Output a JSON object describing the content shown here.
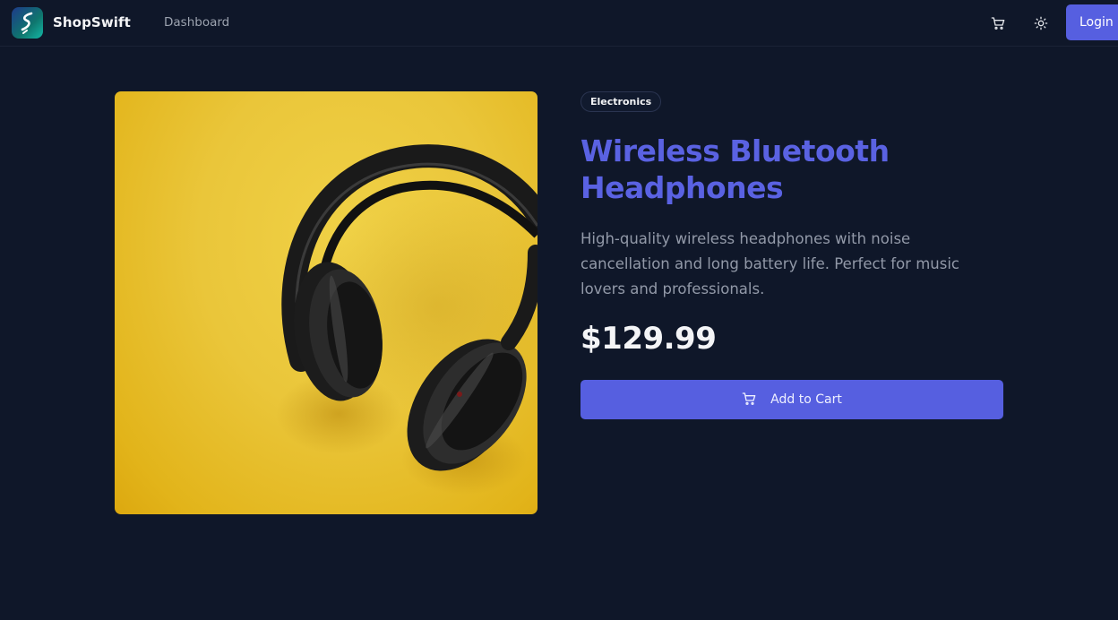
{
  "navbar": {
    "brand": "ShopSwift",
    "links": [
      {
        "label": "Dashboard"
      }
    ],
    "cart_icon": "cart-icon",
    "theme_icon": "sun-icon",
    "login_label": "Login"
  },
  "product": {
    "category": "Electronics",
    "title": "Wireless Bluetooth Headphones",
    "description": "High-quality wireless headphones with noise cancellation and long battery life. Perfect for music lovers and professionals.",
    "price": "$129.99",
    "add_to_cart_label": "Add to Cart",
    "add_to_cart_icon": "cart-icon",
    "image": "headphones-on-yellow-background"
  },
  "colors": {
    "background": "#0f1729",
    "accent": "#565fe0",
    "title": "#5a62e2",
    "muted_text": "#9299a8",
    "image_background": "#eac63a"
  }
}
